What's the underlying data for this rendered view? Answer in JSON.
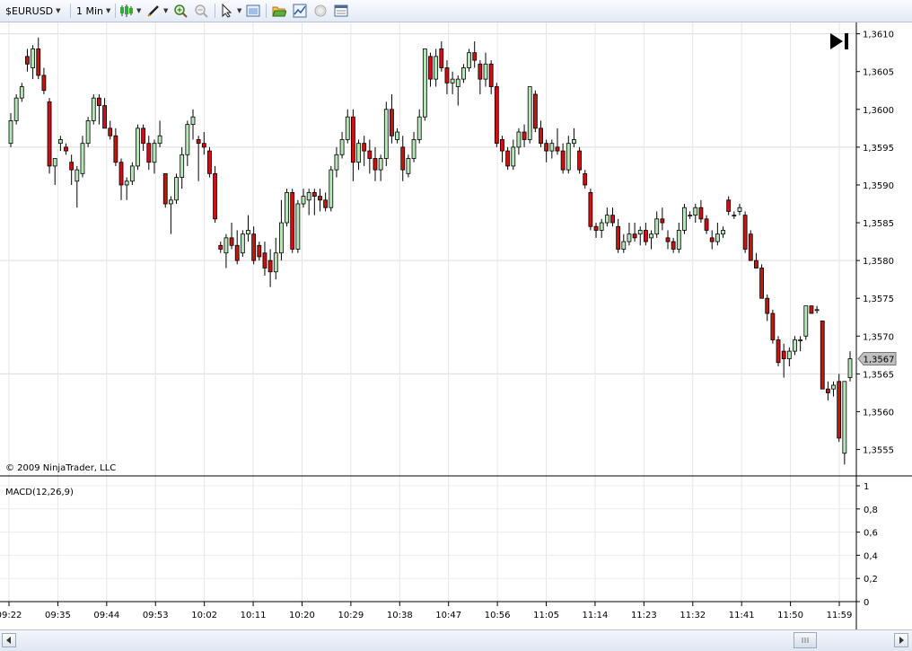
{
  "toolbar": {
    "instrument": "$EURUSD",
    "interval": "1 Min",
    "icons": [
      "candlestick-icon",
      "pencil-draw-icon",
      "zoom-in-icon",
      "zoom-out-icon",
      "pointer-icon",
      "data-box-icon",
      "folder-open-icon",
      "indicators-icon",
      "strategy-icon",
      "properties-icon"
    ]
  },
  "chart": {
    "copyright": "© 2009 NinjaTrader, LLC",
    "last_price_label": "1,3567",
    "indicator_label": "MACD(12,26,9)",
    "colors": {
      "up": "#b8e6b8",
      "down": "#cc1111",
      "grid": "#dcdcdc",
      "outline": "#000000",
      "price_marker": "#c0c0c0"
    }
  },
  "chart_data": [
    {
      "type": "candlestick",
      "instrument": "$EURUSD",
      "interval": "1 Min",
      "xlabel": "",
      "ylabel": "",
      "x_ticks": [
        "09:22",
        "09:35",
        "09:44",
        "09:53",
        "10:02",
        "10:11",
        "10:20",
        "10:29",
        "10:38",
        "10:47",
        "10:56",
        "11:05",
        "11:14",
        "11:23",
        "11:32",
        "11:41",
        "11:50",
        "11:59"
      ],
      "y_ticks": [
        "1,3610",
        "1,3605",
        "1,3600",
        "1,3595",
        "1,3590",
        "1,3585",
        "1,3580",
        "1,3575",
        "1,3570",
        "1,3565",
        "1,3560",
        "1,3555"
      ],
      "ylim": [
        1.35515,
        1.36115
      ],
      "last": 1.3567,
      "candles": [
        [
          1.35955,
          1.35995,
          1.3595,
          1.35985
        ],
        [
          1.35985,
          1.3602,
          1.3598,
          1.36015
        ],
        [
          1.36015,
          1.36035,
          1.3601,
          1.3603
        ],
        [
          1.3607,
          1.3608,
          1.3605,
          1.3606
        ],
        [
          1.36055,
          1.36085,
          1.3604,
          1.3608
        ],
        [
          1.3608,
          1.36095,
          1.3604,
          1.36045
        ],
        [
          1.36045,
          1.36055,
          1.3602,
          1.36025
        ],
        [
          1.3601,
          1.36015,
          1.35915,
          1.35925
        ],
        [
          1.35925,
          1.35935,
          1.359,
          1.35935
        ],
        [
          1.35955,
          1.35965,
          1.35945,
          1.3596
        ],
        [
          1.3595,
          1.35955,
          1.3594,
          1.35945
        ],
        [
          1.3593,
          1.3594,
          1.359,
          1.3592
        ],
        [
          1.35905,
          1.35925,
          1.3587,
          1.3592
        ],
        [
          1.35915,
          1.35965,
          1.3591,
          1.35955
        ],
        [
          1.35955,
          1.3599,
          1.3595,
          1.35985
        ],
        [
          1.35985,
          1.3602,
          1.3598,
          1.36015
        ],
        [
          1.36015,
          1.3602,
          1.3598,
          1.36005
        ],
        [
          1.36005,
          1.36015,
          1.35975,
          1.35975
        ],
        [
          1.35975,
          1.35985,
          1.3596,
          1.35965
        ],
        [
          1.35965,
          1.35975,
          1.35925,
          1.3593
        ],
        [
          1.3593,
          1.35935,
          1.3588,
          1.359
        ],
        [
          1.359,
          1.3591,
          1.3588,
          1.35905
        ],
        [
          1.35905,
          1.3593,
          1.359,
          1.35925
        ],
        [
          1.35925,
          1.3598,
          1.3592,
          1.35975
        ],
        [
          1.35975,
          1.3598,
          1.35945,
          1.35955
        ],
        [
          1.35955,
          1.35965,
          1.3592,
          1.3593
        ],
        [
          1.3593,
          1.3596,
          1.35915,
          1.35955
        ],
        [
          1.35955,
          1.35985,
          1.3595,
          1.35965
        ],
        [
          1.35915,
          1.35915,
          1.3587,
          1.35875
        ],
        [
          1.35875,
          1.35885,
          1.35835,
          1.3588
        ],
        [
          1.3588,
          1.35915,
          1.35875,
          1.3591
        ],
        [
          1.3591,
          1.3595,
          1.35895,
          1.3594
        ],
        [
          1.3594,
          1.35985,
          1.35925,
          1.3598
        ],
        [
          1.3598,
          1.36,
          1.3596,
          1.3599
        ],
        [
          1.3596,
          1.35965,
          1.35905,
          1.35955
        ],
        [
          1.35955,
          1.3597,
          1.3594,
          1.3595
        ],
        [
          1.35945,
          1.3595,
          1.3591,
          1.35915
        ],
        [
          1.35915,
          1.35925,
          1.3585,
          1.35855
        ],
        [
          1.3582,
          1.35825,
          1.3581,
          1.35815
        ],
        [
          1.3581,
          1.35835,
          1.3579,
          1.3583
        ],
        [
          1.3583,
          1.3585,
          1.35815,
          1.3582
        ],
        [
          1.3582,
          1.3584,
          1.35795,
          1.358
        ],
        [
          1.3581,
          1.3584,
          1.35805,
          1.35835
        ],
        [
          1.35835,
          1.3586,
          1.35825,
          1.3584
        ],
        [
          1.35835,
          1.35845,
          1.35795,
          1.358
        ],
        [
          1.3582,
          1.35825,
          1.358,
          1.35805
        ],
        [
          1.3581,
          1.35825,
          1.3578,
          1.3579
        ],
        [
          1.358,
          1.35815,
          1.35765,
          1.35785
        ],
        [
          1.35785,
          1.3583,
          1.35775,
          1.3581
        ],
        [
          1.3581,
          1.3588,
          1.358,
          1.3585
        ],
        [
          1.3585,
          1.35895,
          1.35845,
          1.3589
        ],
        [
          1.3589,
          1.35895,
          1.3581,
          1.35815
        ],
        [
          1.35815,
          1.3588,
          1.3581,
          1.35875
        ],
        [
          1.35875,
          1.35895,
          1.3587,
          1.35885
        ],
        [
          1.3588,
          1.35895,
          1.3586,
          1.3589
        ],
        [
          1.3589,
          1.35895,
          1.3586,
          1.35885
        ],
        [
          1.35885,
          1.35895,
          1.35865,
          1.3588
        ],
        [
          1.3588,
          1.3589,
          1.35865,
          1.3587
        ],
        [
          1.3587,
          1.35925,
          1.35865,
          1.3592
        ],
        [
          1.3592,
          1.3595,
          1.3591,
          1.3594
        ],
        [
          1.3594,
          1.3597,
          1.35935,
          1.3596
        ],
        [
          1.3596,
          1.36,
          1.35955,
          1.3599
        ],
        [
          1.3599,
          1.36,
          1.35905,
          1.3593
        ],
        [
          1.3593,
          1.3596,
          1.3592,
          1.35955
        ],
        [
          1.35955,
          1.35965,
          1.35925,
          1.35945
        ],
        [
          1.35945,
          1.3596,
          1.35915,
          1.35935
        ],
        [
          1.35935,
          1.3595,
          1.35905,
          1.3592
        ],
        [
          1.3592,
          1.3594,
          1.35905,
          1.35935
        ],
        [
          1.35935,
          1.3601,
          1.35925,
          1.36
        ],
        [
          1.36,
          1.3602,
          1.35955,
          1.35965
        ],
        [
          1.3596,
          1.35975,
          1.35955,
          1.3597
        ],
        [
          1.3595,
          1.35965,
          1.35905,
          1.3592
        ],
        [
          1.35915,
          1.3594,
          1.3591,
          1.35935
        ],
        [
          1.35935,
          1.3597,
          1.3593,
          1.3596
        ],
        [
          1.3596,
          1.36,
          1.35955,
          1.3599
        ],
        [
          1.3599,
          1.3608,
          1.35985,
          1.3608
        ],
        [
          1.3607,
          1.36075,
          1.3603,
          1.3604
        ],
        [
          1.3604,
          1.3608,
          1.3603,
          1.3607
        ],
        [
          1.3608,
          1.3609,
          1.3605,
          1.36055
        ],
        [
          1.36055,
          1.36065,
          1.3602,
          1.36035
        ],
        [
          1.36035,
          1.3605,
          1.3602,
          1.3604
        ],
        [
          1.3603,
          1.36045,
          1.36005,
          1.3604
        ],
        [
          1.3604,
          1.3606,
          1.36035,
          1.36055
        ],
        [
          1.36055,
          1.3608,
          1.3605,
          1.36075
        ],
        [
          1.36075,
          1.3609,
          1.36055,
          1.36065
        ],
        [
          1.3606,
          1.36065,
          1.3602,
          1.3604
        ],
        [
          1.3604,
          1.36075,
          1.3603,
          1.3606
        ],
        [
          1.3606,
          1.36065,
          1.3602,
          1.3603
        ],
        [
          1.3603,
          1.36035,
          1.3595,
          1.35955
        ],
        [
          1.3596,
          1.35965,
          1.3593,
          1.35945
        ],
        [
          1.35945,
          1.3595,
          1.3592,
          1.35925
        ],
        [
          1.35925,
          1.3596,
          1.3592,
          1.3595
        ],
        [
          1.3595,
          1.35975,
          1.3594,
          1.3597
        ],
        [
          1.3597,
          1.3598,
          1.3595,
          1.3596
        ],
        [
          1.3596,
          1.3603,
          1.35955,
          1.3603
        ],
        [
          1.3602,
          1.36025,
          1.3597,
          1.35975
        ],
        [
          1.35975,
          1.35985,
          1.3595,
          1.35955
        ],
        [
          1.35955,
          1.3596,
          1.3593,
          1.35945
        ],
        [
          1.35945,
          1.3596,
          1.35935,
          1.35955
        ],
        [
          1.3595,
          1.35975,
          1.3594,
          1.35945
        ],
        [
          1.35945,
          1.35955,
          1.35915,
          1.3592
        ],
        [
          1.3592,
          1.35965,
          1.35915,
          1.35955
        ],
        [
          1.35955,
          1.35975,
          1.3595,
          1.3596
        ],
        [
          1.35945,
          1.3595,
          1.35915,
          1.3592
        ],
        [
          1.35915,
          1.3592,
          1.35895,
          1.359
        ],
        [
          1.3589,
          1.35895,
          1.3584,
          1.35845
        ],
        [
          1.35845,
          1.3585,
          1.3583,
          1.3584
        ],
        [
          1.3584,
          1.35855,
          1.3583,
          1.3585
        ],
        [
          1.3585,
          1.3587,
          1.35845,
          1.3586
        ],
        [
          1.3586,
          1.3587,
          1.35845,
          1.3585
        ],
        [
          1.35845,
          1.35855,
          1.3581,
          1.35815
        ],
        [
          1.35815,
          1.35835,
          1.3581,
          1.35825
        ],
        [
          1.35825,
          1.3585,
          1.3582,
          1.35835
        ],
        [
          1.35835,
          1.3585,
          1.35825,
          1.3583
        ],
        [
          1.35835,
          1.35845,
          1.3582,
          1.3584
        ],
        [
          1.3584,
          1.3585,
          1.3582,
          1.35825
        ],
        [
          1.3583,
          1.3584,
          1.35815,
          1.35835
        ],
        [
          1.35835,
          1.35865,
          1.3583,
          1.35855
        ],
        [
          1.35855,
          1.3587,
          1.3584,
          1.3585
        ],
        [
          1.3583,
          1.3584,
          1.35815,
          1.35825
        ],
        [
          1.35825,
          1.3583,
          1.3581,
          1.35815
        ],
        [
          1.35815,
          1.3585,
          1.3581,
          1.3584
        ],
        [
          1.3584,
          1.35875,
          1.35835,
          1.3587
        ],
        [
          1.3586,
          1.35865,
          1.35855,
          1.3586
        ],
        [
          1.3586,
          1.35875,
          1.3585,
          1.3587
        ],
        [
          1.3587,
          1.3588,
          1.3585,
          1.35855
        ],
        [
          1.35855,
          1.3586,
          1.35835,
          1.3584
        ],
        [
          1.3583,
          1.3584,
          1.35815,
          1.35825
        ],
        [
          1.35825,
          1.3585,
          1.3582,
          1.35835
        ],
        [
          1.35835,
          1.35845,
          1.3583,
          1.3584
        ],
        [
          1.3588,
          1.35885,
          1.3586,
          1.35865
        ],
        [
          1.3586,
          1.35865,
          1.35855,
          1.3586
        ],
        [
          1.35865,
          1.35875,
          1.3586,
          1.3587
        ],
        [
          1.3586,
          1.35865,
          1.3581,
          1.35815
        ],
        [
          1.35835,
          1.3584,
          1.358,
          1.358
        ],
        [
          1.358,
          1.3581,
          1.3579,
          1.3579
        ],
        [
          1.3579,
          1.35795,
          1.3575,
          1.3575
        ],
        [
          1.3575,
          1.35755,
          1.3572,
          1.3573
        ],
        [
          1.3573,
          1.35735,
          1.3569,
          1.35695
        ],
        [
          1.35695,
          1.357,
          1.3566,
          1.35665
        ],
        [
          1.3568,
          1.3569,
          1.35645,
          1.3567
        ],
        [
          1.3567,
          1.35685,
          1.3566,
          1.3568
        ],
        [
          1.3568,
          1.357,
          1.35675,
          1.35695
        ],
        [
          1.35695,
          1.357,
          1.3568,
          1.35695
        ],
        [
          1.357,
          1.3574,
          1.35695,
          1.3574
        ],
        [
          1.3574,
          1.3574,
          1.3573,
          1.3573
        ],
        [
          1.35735,
          1.3574,
          1.3573,
          1.35735
        ],
        [
          1.3572,
          1.3572,
          1.3563,
          1.3563
        ],
        [
          1.3563,
          1.3564,
          1.35615,
          1.35625
        ],
        [
          1.3563,
          1.3564,
          1.3562,
          1.35635
        ],
        [
          1.3564,
          1.3565,
          1.3556,
          1.35565
        ],
        [
          1.35545,
          1.3564,
          1.3553,
          1.3564
        ],
        [
          1.35645,
          1.3568,
          1.3564,
          1.3567
        ]
      ]
    },
    {
      "type": "line",
      "title": "MACD(12,26,9)",
      "y_ticks": [
        "1",
        "0,8",
        "0,6",
        "0,4",
        "0,2",
        "0"
      ],
      "ylim": [
        0,
        1
      ],
      "series": []
    }
  ]
}
